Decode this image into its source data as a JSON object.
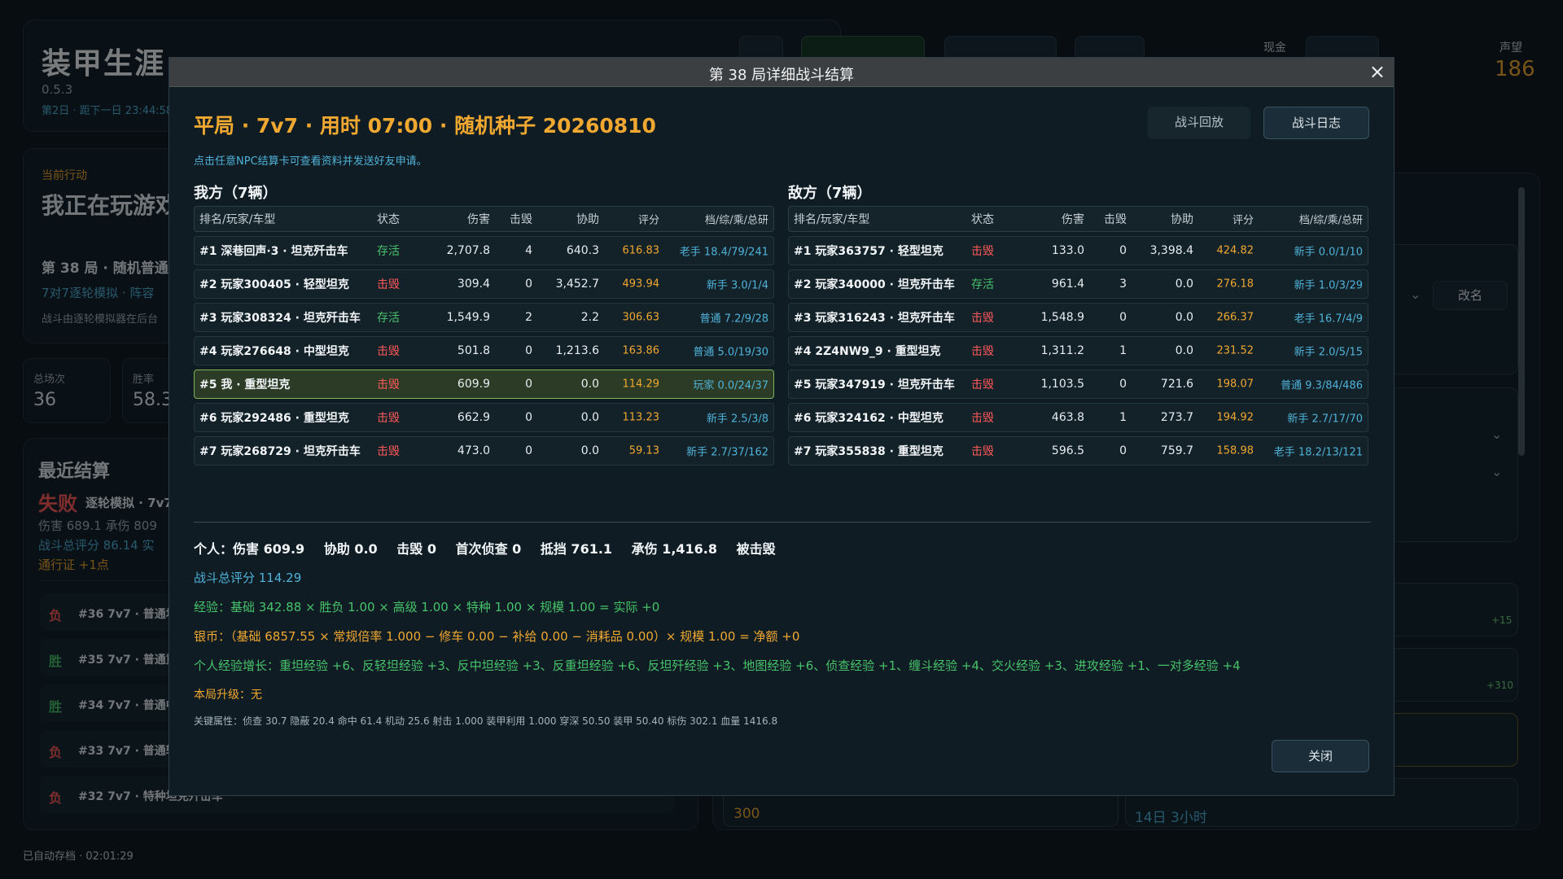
{
  "app": {
    "title": "装甲生涯",
    "version": "0.5.3",
    "day_line": "第2日 · 距下一日 23:44:58",
    "cash_label": "现金",
    "fame_label": "声望",
    "fame_value": "186",
    "autosave": "已自动存档 · 02:01:29"
  },
  "action": {
    "label": "当前行动",
    "title": "我正在玩游戏",
    "round": "第 38 局 · 随机普通",
    "sub": "7对7逐轮模拟 · 阵容",
    "note": "战斗由逐轮模拟器在后台"
  },
  "stats": [
    {
      "label": "总场次",
      "value": "36"
    },
    {
      "label": "胜率",
      "value": "58.3"
    }
  ],
  "recent": {
    "title": "最近结算",
    "last_result": "失败",
    "last_mode": "逐轮模拟 · 7v7",
    "line1": "伤害 689.1  承伤 809",
    "line2": "战斗总评分 86.14  实",
    "line3": "通行证 +1点",
    "history": [
      {
        "result": "负",
        "text": "#36 7v7 · 普通坦"
      },
      {
        "result": "胜",
        "text": "#35 7v7 · 普通重"
      },
      {
        "result": "胜",
        "text": "#34 7v7 · 普通中"
      },
      {
        "result": "负",
        "text": "#33 7v7 · 普通轻"
      },
      {
        "result": "负",
        "text": "#32 7v7 · 特种坦克歼击车"
      }
    ]
  },
  "side": {
    "rename": "改名",
    "plus1": "+15",
    "plus2": "+310",
    "val1": "300",
    "val2": "14日 3小时"
  },
  "modal": {
    "title": "第 38 局详细战斗结算",
    "close_icon": "×",
    "headline": "平局 · 7v7 · 用时 07:00 · 随机种子 20260810",
    "replay_btn": "战斗回放",
    "log_btn": "战斗日志",
    "hint": "点击任意NPC结算卡可查看资料并发送好友申请。",
    "columns": {
      "name": "排名/玩家/车型",
      "status": "状态",
      "damage": "伤害",
      "kills": "击毁",
      "assist": "协助",
      "score": "评分",
      "tier": "档/综/乘/总研"
    },
    "ally": {
      "title": "我方（7辆）",
      "rows": [
        {
          "name": "#1 深巷回声·3 · 坦克歼击车",
          "status": "存活",
          "damage": "2,707.8",
          "kills": "4",
          "assist": "640.3",
          "score": "616.83",
          "tier": "老手 18.4/79/241"
        },
        {
          "name": "#2 玩家300405 · 轻型坦克",
          "status": "击毁",
          "damage": "309.4",
          "kills": "0",
          "assist": "3,452.7",
          "score": "493.94",
          "tier": "新手 3.0/1/4"
        },
        {
          "name": "#3 玩家308324 · 坦克歼击车",
          "status": "存活",
          "damage": "1,549.9",
          "kills": "2",
          "assist": "2.2",
          "score": "306.63",
          "tier": "普通 7.2/9/28"
        },
        {
          "name": "#4 玩家276648 · 中型坦克",
          "status": "击毁",
          "damage": "501.8",
          "kills": "0",
          "assist": "1,213.6",
          "score": "163.86",
          "tier": "普通 5.0/19/30"
        },
        {
          "name": "#5 我 · 重型坦克",
          "status": "击毁",
          "damage": "609.9",
          "kills": "0",
          "assist": "0.0",
          "score": "114.29",
          "tier": "玩家 0.0/24/37",
          "me": true
        },
        {
          "name": "#6 玩家292486 · 重型坦克",
          "status": "击毁",
          "damage": "662.9",
          "kills": "0",
          "assist": "0.0",
          "score": "113.23",
          "tier": "新手 2.5/3/8"
        },
        {
          "name": "#7 玩家268729 · 坦克歼击车",
          "status": "击毁",
          "damage": "473.0",
          "kills": "0",
          "assist": "0.0",
          "score": "59.13",
          "tier": "新手 2.7/37/162"
        }
      ]
    },
    "enemy": {
      "title": "敌方（7辆）",
      "rows": [
        {
          "name": "#1 玩家363757 · 轻型坦克",
          "status": "击毁",
          "damage": "133.0",
          "kills": "0",
          "assist": "3,398.4",
          "score": "424.82",
          "tier": "新手 0.0/1/10"
        },
        {
          "name": "#2 玩家340000 · 坦克歼击车",
          "status": "存活",
          "damage": "961.4",
          "kills": "3",
          "assist": "0.0",
          "score": "276.18",
          "tier": "新手 1.0/3/29"
        },
        {
          "name": "#3 玩家316243 · 坦克歼击车",
          "status": "击毁",
          "damage": "1,548.9",
          "kills": "0",
          "assist": "0.0",
          "score": "266.37",
          "tier": "老手 16.7/4/9"
        },
        {
          "name": "#4 2Z4NW9_9 · 重型坦克",
          "status": "击毁",
          "damage": "1,311.2",
          "kills": "1",
          "assist": "0.0",
          "score": "231.52",
          "tier": "新手 2.0/5/15"
        },
        {
          "name": "#5 玩家347919 · 坦克歼击车",
          "status": "击毁",
          "damage": "1,103.5",
          "kills": "0",
          "assist": "721.6",
          "score": "198.07",
          "tier": "普通 9.3/84/486"
        },
        {
          "name": "#6 玩家324162 · 中型坦克",
          "status": "击毁",
          "damage": "463.8",
          "kills": "1",
          "assist": "273.7",
          "score": "194.92",
          "tier": "新手 2.7/17/70"
        },
        {
          "name": "#7 玩家355838 · 重型坦克",
          "status": "击毁",
          "damage": "596.5",
          "kills": "0",
          "assist": "759.7",
          "score": "158.98",
          "tier": "老手 18.2/13/121"
        }
      ]
    },
    "personal": [
      "个人：伤害 609.9",
      "协助 0.0",
      "击毁 0",
      "首次侦查 0",
      "抵挡 761.1",
      "承伤 1,416.8",
      "被击毁"
    ],
    "score_line": "战斗总评分 114.29",
    "exp_line": "经验：基础 342.88 × 胜负 1.00 × 高级 1.00 × 特种 1.00 × 规模 1.00 = 实际 +0",
    "silver_line": "银币：（基础 6857.55 × 常规倍率 1.000 − 修车 0.00 − 补给 0.00 − 消耗品 0.00）× 规模 1.00 = 净额 +0",
    "growth_line": "个人经验增长：重坦经验 +6、反轻坦经验 +3、反中坦经验 +3、反重坦经验 +6、反坦歼经验 +3、地图经验 +6、侦查经验 +1、缠斗经验 +4、交火经验 +3、进攻经验 +1、一对多经验 +4",
    "upgrade_line": "本局升级：无",
    "attr_line": "关键属性：侦查 30.7   隐蔽 20.4   命中 61.4   机动 25.6   射击 1.000   装甲利用 1.000   穿深 50.50   装甲 50.40   标伤 302.1   血量 1416.8",
    "close_btn": "关闭"
  }
}
